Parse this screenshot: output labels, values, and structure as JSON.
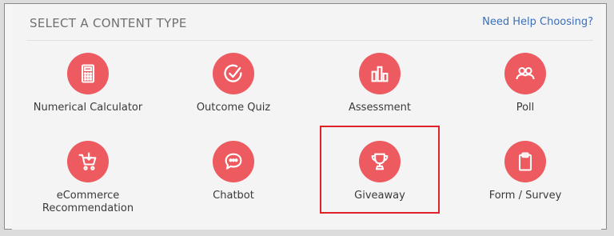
{
  "header": {
    "title": "SELECT A CONTENT TYPE",
    "help_link": "Need Help Choosing?"
  },
  "content_types": [
    {
      "label": "Numerical Calculator",
      "icon": "calculator-icon"
    },
    {
      "label": "Outcome Quiz",
      "icon": "checkmark-circle-icon"
    },
    {
      "label": "Assessment",
      "icon": "bar-chart-icon"
    },
    {
      "label": "Poll",
      "icon": "users-icon"
    },
    {
      "label": "eCommerce Recommendation",
      "icon": "shopping-cart-icon"
    },
    {
      "label": "Chatbot",
      "icon": "chat-bubble-icon"
    },
    {
      "label": "Giveaway",
      "icon": "trophy-icon"
    },
    {
      "label": "Form / Survey",
      "icon": "clipboard-icon"
    }
  ],
  "highlighted_item": "Giveaway",
  "colors": {
    "accent": "#ed5a5f",
    "highlight_border": "#e0232a",
    "link": "#3b6fb6"
  }
}
